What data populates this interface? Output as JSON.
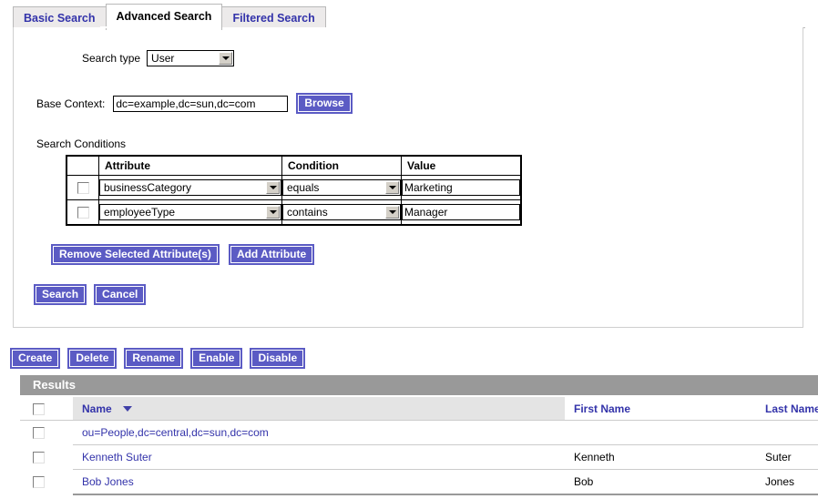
{
  "tabs": [
    {
      "label": "Basic Search",
      "active": false
    },
    {
      "label": "Advanced Search",
      "active": true
    },
    {
      "label": "Filtered Search",
      "active": false
    }
  ],
  "search_form": {
    "search_type_label": "Search type",
    "search_type_value": "User",
    "base_context_label": "Base Context:",
    "base_context_value": "dc=example,dc=sun,dc=com",
    "browse_label": "Browse",
    "conditions_label": "Search Conditions",
    "columns": [
      "",
      "Attribute",
      "Condition",
      "Value"
    ],
    "rows": [
      {
        "checked": false,
        "attribute": "businessCategory",
        "condition": "equals",
        "value": "Marketing"
      },
      {
        "checked": false,
        "attribute": "employeeType",
        "condition": "contains",
        "value": "Manager"
      }
    ],
    "remove_label": "Remove Selected Attribute(s)",
    "add_label": "Add Attribute",
    "search_label": "Search",
    "cancel_label": "Cancel"
  },
  "action_bar": {
    "buttons": [
      "Create",
      "Delete",
      "Rename",
      "Enable",
      "Disable"
    ]
  },
  "results": {
    "title": "Results",
    "columns": [
      "",
      "Name",
      "First Name",
      "Last Name"
    ],
    "sorted_column": "Name",
    "sort_direction": "descending",
    "rows": [
      {
        "checked": false,
        "name": "ou=People,dc=central,dc=sun,dc=com",
        "first_name": "",
        "last_name": ""
      },
      {
        "checked": false,
        "name": "Kenneth Suter",
        "first_name": "Kenneth",
        "last_name": "Suter"
      },
      {
        "checked": false,
        "name": "Bob Jones",
        "first_name": "Bob",
        "last_name": "Jones"
      }
    ]
  },
  "colors": {
    "accent_purple": "#5b5bc4",
    "link_blue": "#3333aa",
    "results_bar_gray": "#999999",
    "sorted_col_gray": "#e4e4e4",
    "tab_inactive_gray": "#eceaea"
  }
}
